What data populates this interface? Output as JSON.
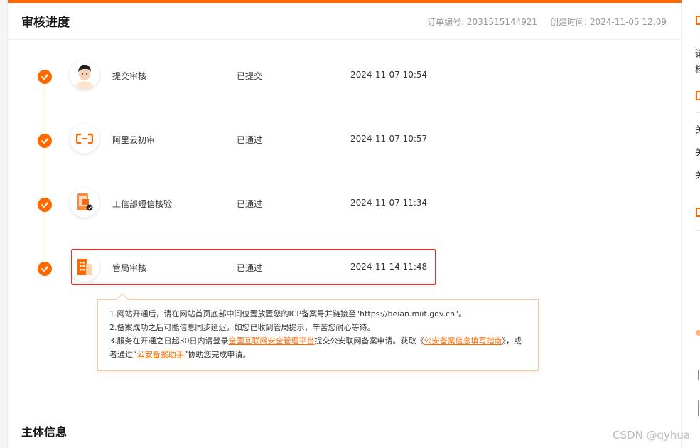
{
  "panel": {
    "title": "审核进度",
    "order_no_label": "订单编号: 2031515144921",
    "created_label": "创建时间: 2024-11-05 12:09"
  },
  "steps": [
    {
      "name": "提交审核",
      "status": "已提交",
      "time": "2024-11-07 10:54",
      "icon": "person-avatar-icon"
    },
    {
      "name": "阿里云初审",
      "status": "已通过",
      "time": "2024-11-07 10:57",
      "icon": "aliyun-logo-icon"
    },
    {
      "name": "工信部短信核验",
      "status": "已通过",
      "time": "2024-11-07 11:34",
      "icon": "phone-verify-icon"
    },
    {
      "name": "管局审核",
      "status": "已通过",
      "time": "2024-11-14 11:48",
      "icon": "building-icon"
    }
  ],
  "tooltip": {
    "line1": "1.网站开通后，请在网站首页底部中间位置放置您的ICP备案号并链接至\"https://beian.miit.gov.cn\"。",
    "line2": "2.备案成功之后可能信息同步延迟，如您已收到管局提示，辛苦您耐心等待。",
    "line3_pre": "3.服务在开通之日起30日内请登录",
    "line3_link1": "全国互联网安全管理平台",
    "line3_mid": "提交公安联网备案申请。获取《",
    "line3_link2": "公安备案信息填写指南",
    "line3_mid2": "》，或者通过“",
    "line3_link3": "公安备案助手",
    "line3_post": "”协助您完成申请。"
  },
  "section2": {
    "title": "主体信息"
  },
  "sidebar": {
    "chars": [
      "请",
      "核",
      "关",
      "关",
      "关"
    ]
  },
  "watermark": "CSDN @qyhua",
  "colors": {
    "accent": "#ff6a00",
    "highlight": "#e5322d"
  }
}
